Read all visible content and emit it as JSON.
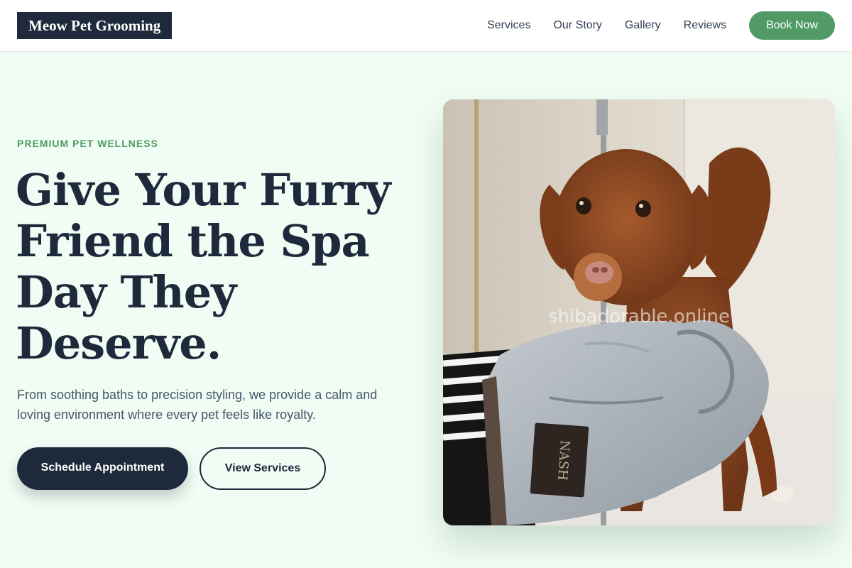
{
  "brand": {
    "logo_text": "Meow Pet Grooming"
  },
  "nav": {
    "links": [
      "Services",
      "Our Story",
      "Gallery",
      "Reviews"
    ],
    "cta": "Book Now"
  },
  "hero": {
    "eyebrow": "PREMIUM PET WELLNESS",
    "headline": "Give Your Furry Friend the Spa Day They Deserve.",
    "subtext": "From soothing baths to precision styling, we provide a calm and loving environment where every pet feels like royalty.",
    "primary_button": "Schedule Appointment",
    "secondary_button": "View Services",
    "image": {
      "watermark": "shibadorable.online",
      "mitt_label": "NASH"
    }
  },
  "colors": {
    "accent": "#4f9a65",
    "dark": "#1e293b",
    "background": "#f0fdf4"
  }
}
